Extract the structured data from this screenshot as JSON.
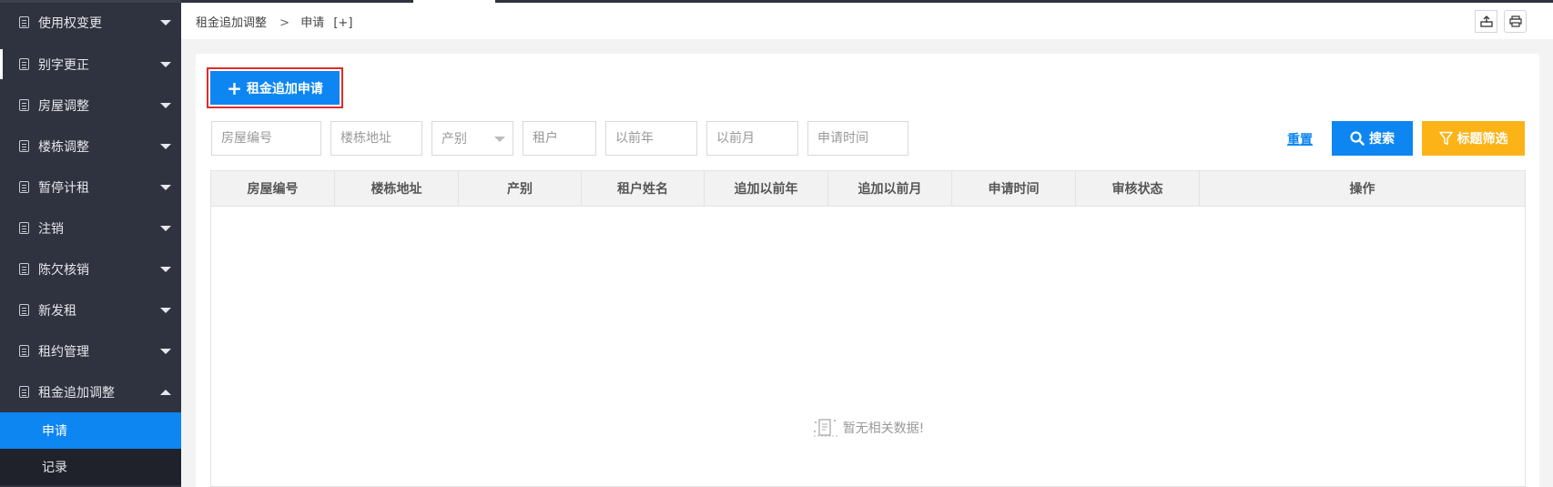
{
  "sidebar": {
    "items": [
      {
        "label": "使用权变更"
      },
      {
        "label": "别字更正"
      },
      {
        "label": "房屋调整"
      },
      {
        "label": "楼栋调整"
      },
      {
        "label": "暂停计租"
      },
      {
        "label": "注销"
      },
      {
        "label": "陈欠核销"
      },
      {
        "label": "新发租"
      },
      {
        "label": "租约管理"
      },
      {
        "label": "租金追加调整"
      }
    ],
    "subitems": [
      {
        "label": "申请"
      },
      {
        "label": "记录"
      }
    ]
  },
  "breadcrumb": {
    "section": "租金追加调整",
    "separator": ">",
    "page": "申请",
    "expand": "[+]"
  },
  "toolbar": {
    "add_label": "租金追加申请",
    "reset_label": "重置",
    "search_label": "搜索",
    "filter_label": "标题筛选"
  },
  "filters": {
    "house_no": {
      "placeholder": "房屋编号"
    },
    "building_address": {
      "placeholder": "楼栋地址"
    },
    "property_type": {
      "value": "产别"
    },
    "tenant": {
      "placeholder": "租户"
    },
    "prev_year": {
      "placeholder": "以前年"
    },
    "prev_month": {
      "placeholder": "以前月"
    },
    "apply_time": {
      "placeholder": "申请时间"
    }
  },
  "table": {
    "columns": [
      "房屋编号",
      "楼栋地址",
      "产别",
      "租户姓名",
      "追加以前年",
      "追加以前月",
      "申请时间",
      "审核状态",
      "操作"
    ],
    "empty_text": "暂无相关数据!"
  },
  "colors": {
    "primary": "#0d86f2",
    "warning": "#fbb317",
    "sidebar_bg": "#2f3340",
    "highlight_border": "#e22b2b"
  }
}
